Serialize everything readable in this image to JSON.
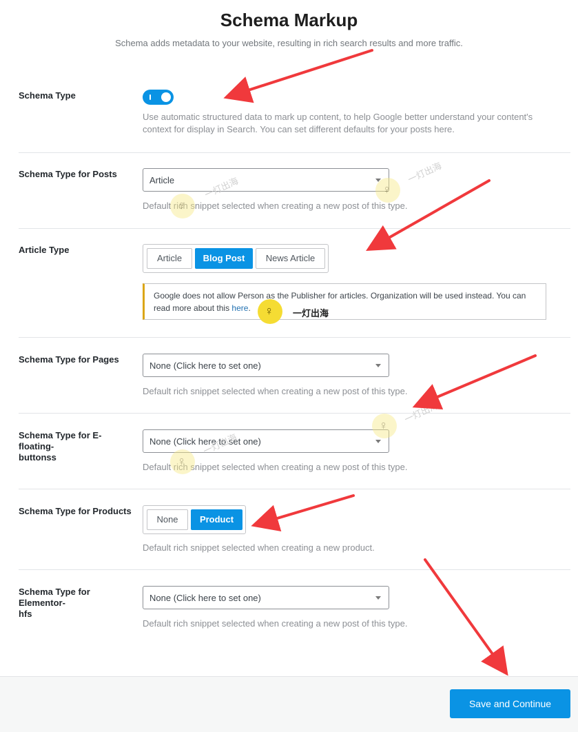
{
  "header": {
    "title": "Schema Markup",
    "subtitle": "Schema adds metadata to your website, resulting in rich search results and more traffic."
  },
  "schema_type": {
    "label": "Schema Type",
    "enabled": true,
    "description_line1": "Use automatic structured data to mark up content, to help Google better understand your content's",
    "description_line2": "context for display in Search. You can set different defaults for your posts here."
  },
  "posts": {
    "label": "Schema Type for Posts",
    "value": "Article",
    "description": "Default rich snippet selected when creating a new post of this type."
  },
  "article_type": {
    "label": "Article Type",
    "options": [
      "Article",
      "Blog Post",
      "News Article"
    ],
    "selected": "Blog Post",
    "notice_line1": "Google does not allow Person as the Publisher for articles. Organization will be used instead. You can",
    "notice_line2_prefix": "read more about this ",
    "notice_link": "here",
    "notice_suffix": "."
  },
  "pages": {
    "label": "Schema Type for Pages",
    "value": "None (Click here to set one)",
    "description": "Default rich snippet selected when creating a new post of this type."
  },
  "floating": {
    "label_line1": "Schema Type for E-floating-",
    "label_line2": "buttonss",
    "value": "None (Click here to set one)",
    "description": "Default rich snippet selected when creating a new post of this type."
  },
  "products": {
    "label": "Schema Type for Products",
    "options": [
      "None",
      "Product"
    ],
    "selected": "Product",
    "description": "Default rich snippet selected when creating a new product."
  },
  "elementor": {
    "label_line1": "Schema Type for Elementor-",
    "label_line2": "hfs",
    "value": "None (Click here to set one)",
    "description": "Default rich snippet selected when creating a new post of this type."
  },
  "footer": {
    "save_label": "Save and Continue"
  },
  "watermark": {
    "text": "一灯出海"
  },
  "colors": {
    "accent": "#0a93e4",
    "notice_border": "#dba617",
    "arrow": "#f0393c"
  }
}
